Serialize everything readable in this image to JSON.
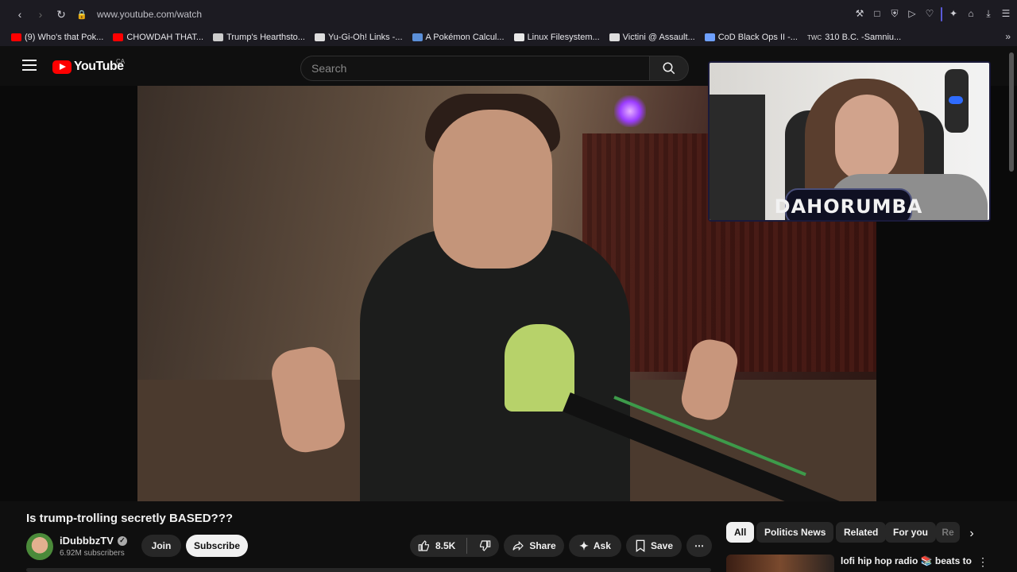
{
  "browser": {
    "url": "www.youtube.com/watch",
    "bookmarks": [
      {
        "label": "(9) Who's that Pok...",
        "color": "#ff0000"
      },
      {
        "label": "CHOWDAH THAT...",
        "color": "#ff0000"
      },
      {
        "label": "Trump's Hearthsto...",
        "color": "#cccccc"
      },
      {
        "label": "Yu-Gi-Oh! Links -...",
        "color": "#dddddd"
      },
      {
        "label": "A Pokémon Calcul...",
        "color": "#5b8fd8"
      },
      {
        "label": "Linux Filesystem...",
        "color": "#e8e8e8"
      },
      {
        "label": "Victini @ Assault...",
        "color": "#dddddd"
      },
      {
        "label": "CoD Black Ops II -...",
        "color": "#6ea0ff"
      },
      {
        "label": "310 B.C. -Samniu...",
        "color": "#bbbbbb"
      }
    ],
    "bookmark_icon_text": "TWC"
  },
  "youtube": {
    "logo_text": "YouTube",
    "region": "CA",
    "search_placeholder": "Search"
  },
  "overlay": {
    "streamer_name": "DAHORUMBA"
  },
  "video": {
    "title": "Is trump-trolling secretly BASED???",
    "channel": "iDubbbzTV",
    "subscribers": "6.92M subscribers",
    "join_label": "Join",
    "subscribe_label": "Subscribe",
    "likes": "8.5K",
    "share_label": "Share",
    "ask_label": "Ask",
    "save_label": "Save"
  },
  "chips": [
    {
      "label": "All",
      "active": true
    },
    {
      "label": "Politics News",
      "active": false
    },
    {
      "label": "Related",
      "active": false
    },
    {
      "label": "For you",
      "active": false
    },
    {
      "label": "Re",
      "active": false
    }
  ],
  "recommendation": {
    "title": "lofi hip hop radio 📚 beats to"
  },
  "colors": {
    "accent_red": "#ff0000",
    "background": "#0f0f0f"
  }
}
